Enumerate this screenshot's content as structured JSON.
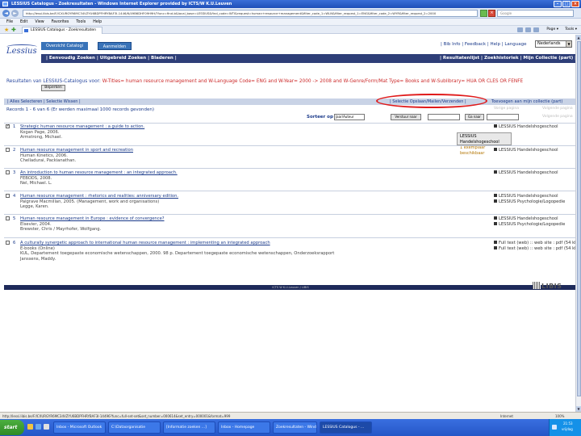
{
  "window": {
    "title": "LESSIUS Catalogus - Zoekresultaten - Windows Internet Explorer provided by ICTS/W K.U.Leuven",
    "controls": {
      "minimize": "–",
      "maximize": "□",
      "close": "×"
    }
  },
  "address_bar": {
    "back": "◄",
    "forward": "►",
    "url": "http://lessi.libis.be/F/ICXURGYR6MC34VZYU6BDPFHRYBAF3I-1446/6/49B6DHF09H9H/?func=find-b&local_base=LESSIUS&find_code=WTI&request=human+resource+management&filter_code_1=WLN&filter_request_1=ENG&filter_code_2=WYR&filter_request_2=2000",
    "search_placeholder": "Google"
  },
  "menu": {
    "items": [
      "File",
      "Edit",
      "View",
      "Favorites",
      "Tools",
      "Help"
    ]
  },
  "favorites_bar": {
    "tab_label": "LESSIUS Catalogus - Zoekresultaten",
    "page_menu": "Page ▾",
    "tools_menu": "Tools ▾"
  },
  "site": {
    "logo": "Lessius",
    "overview_button": "Overzicht Catalogi",
    "advanced_button": "Aanmelden",
    "top_links": "| Bib Info | Feedback | Help | Language",
    "language": "Nederlands",
    "nav_left": "| Eenvoudig Zoeken | Uitgebreid Zoeken | Bladeren |",
    "nav_right": "| Resultatenlijst | Zoekhistoriek | Mijn Collectie (part) |"
  },
  "results": {
    "heading_prefix": "Resultaten van LESSIUS-Catalogus voor:",
    "heading_query": "W-Titles= human resource management and W-Language Code= ENG and W-Year= 2000 -> 2008 and W-Genre/Form/Mat Type= Books and W-Sublibrary= HUA OR CLES OR FENFE",
    "refine_button": "Beperken"
  },
  "actions": {
    "left": "| Alles Selecteren | Selectie Wissen |",
    "middle": "| Selectie Opslaan/Mailen/Verzenden |",
    "right": "Toevoegen aan mijn collectie (part)"
  },
  "summary": {
    "text": "Records 1 - 6 van 6 (Er werden maximaal 1000 records gevonden)",
    "pagination_top": "Vorige pagina",
    "pagination_top_next": "Volgende pagina",
    "pagination_right": "Volgende pagina"
  },
  "sortbar": {
    "label": "Sorteer op",
    "select_value": "Jaar/Auteur",
    "button_1": "Verstuur naar",
    "button_2": "Ga naar"
  },
  "records": [
    {
      "num": "1",
      "title": "Strategic human resource management : a guide to action.",
      "line2": "Kogan Page, 2006.",
      "line3": "Armstrong, Michael.",
      "holding": "LESSIUS Handelshogeschool",
      "checked": true
    },
    {
      "num": "2",
      "title": "Human resource management in sport and recreation",
      "line2": "Human Kinetics, 2006.",
      "line3": "Chelladurai, Packianathan.",
      "holding": "LESSIUS Handelshogeschool",
      "checked": false
    },
    {
      "num": "3",
      "title": "An introduction to human resource management : an integrated approach.",
      "line2": "FEBODS, 2008.",
      "line3": "Nel, Michael. L.",
      "holding": "LESSIUS Handelshogeschool",
      "checked": false
    },
    {
      "num": "4",
      "title": "Human resource management : rhetorics and realities: anniversary edition.",
      "line2": "Palgrave Macmillan, 2005. (Management, work and organisations)",
      "line3": "Legge, Karen.",
      "holding": "LESSIUS Handelshogeschool",
      "holding2": "LESSIUS Psychologie/Logopedie",
      "checked": false
    },
    {
      "num": "5",
      "title": "Human resource management in Europe : evidence of convergence?",
      "line2": "Elsevier, 2004.",
      "line3": "Brewster, Chris / Mayrhofer, Wolfgang.",
      "holding": "LESSIUS Handelshogeschool",
      "holding2": "LESSIUS Psychologie/Logopedie",
      "checked": false
    },
    {
      "num": "6",
      "title": "A culturally synergetic approach to international human resource management : implementing an integrated approach",
      "line2": "E-books (Online)",
      "line3": "KUL, Departement toegepaste economische wetenschappen, 2000. 98 p. Departement toegepaste economische wetenschappen, Onderzoeksrapport",
      "line4": "Janssens, Maddy.",
      "holding": "Full text (web) :: web site : pdf (54 kb)",
      "holding2": "Full text (web) :: web site : pdf (54 kb)",
      "checked": false
    }
  ],
  "tooltip": {
    "line1": "LESSIUS Handelshogeschool",
    "line2": "1 exemplaar beschikbaar"
  },
  "footer": {
    "bar": "ICTS W K.U.Leuven / LIBIS",
    "logo": "LIBIS"
  },
  "statusbar": {
    "url": "http://lessi.libis.be/F/ICXURGYR6MC34VZYU6BDPFHRYBAF3I-14496?func=full-set-set&set_number=000614&set_entry=000001&format=999",
    "zone": "Internet",
    "zoom": "100%"
  },
  "taskbar": {
    "start": "start",
    "tasks": [
      "Inbox - Microsoft Outlook",
      "C:\\Dataorganisatie",
      "[Informatie zoeken ...]",
      "Inbox - Homepage",
      "Zoekresultaten - Windows...",
      "LESSIUS Catalogus - ..."
    ],
    "time": "21:53",
    "date": "vrijdag"
  }
}
